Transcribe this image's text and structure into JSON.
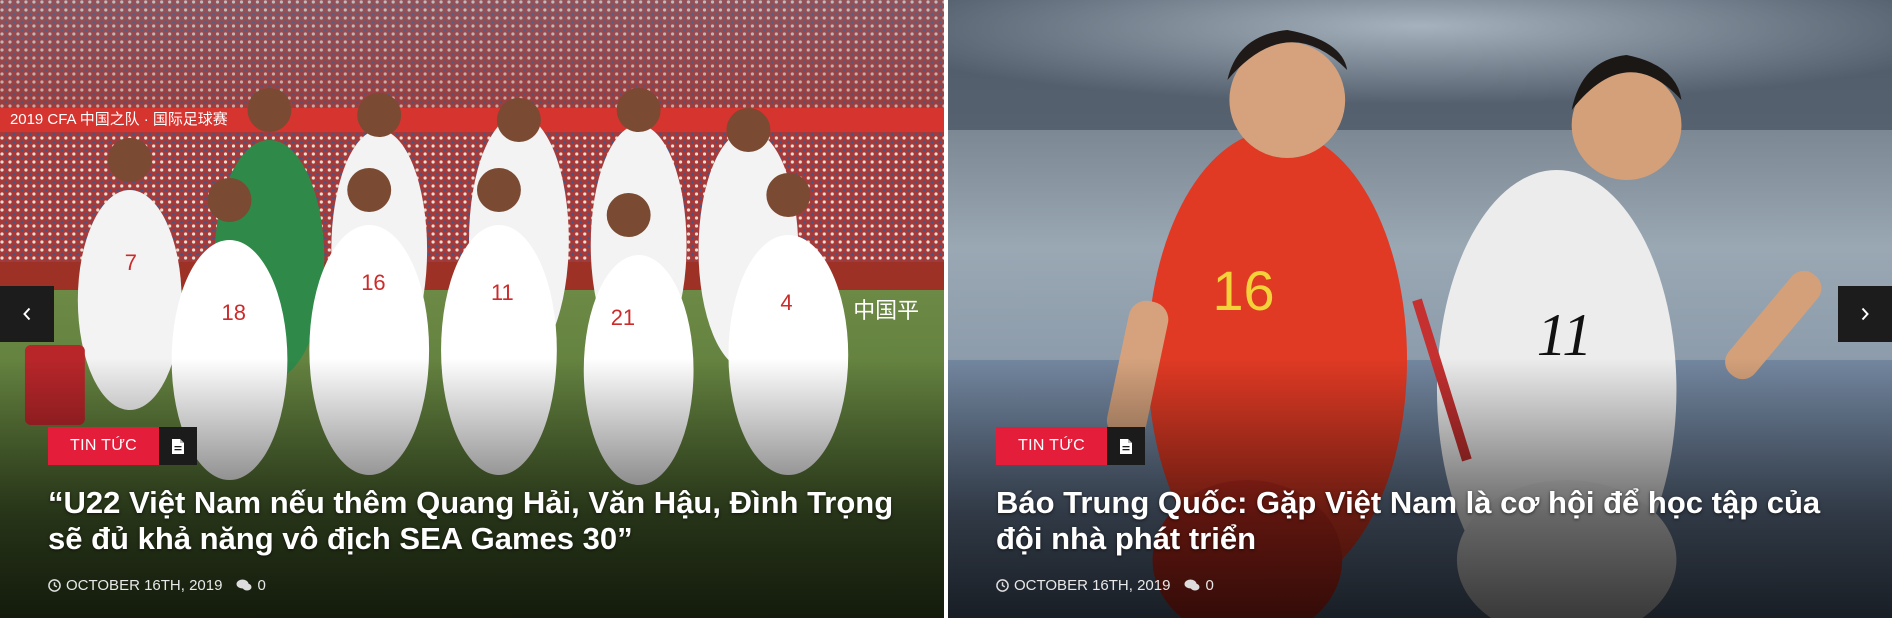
{
  "slides": [
    {
      "category": "TIN TỨC",
      "title": "“U22 Việt Nam nếu thêm Quang Hải, Văn Hậu, Đình Trọng sẽ đủ khả năng vô địch SEA Games 30”",
      "date": "OCTOBER 16TH, 2019",
      "comments": "0",
      "banner_text": "2019 CFA 中国之队 · 国际足球赛",
      "banner_text_2": "中国平",
      "icons": {
        "category": "document-icon",
        "date": "clock-icon",
        "comments": "comments-icon"
      }
    },
    {
      "category": "TIN TỨC",
      "title": "Báo Trung Quốc: Gặp Việt Nam là cơ hội để học tập của đội nhà phát triển",
      "date": "OCTOBER 16TH, 2019",
      "comments": "0",
      "icons": {
        "category": "document-icon",
        "date": "clock-icon",
        "comments": "comments-icon"
      }
    }
  ],
  "navigation": {
    "prev_icon": "chevron-left-icon",
    "next_icon": "chevron-right-icon"
  },
  "colors": {
    "category_bg": "#e41d3a",
    "icon_bg": "#1b1b1b",
    "arrow_bg": "#1c1c1c"
  }
}
